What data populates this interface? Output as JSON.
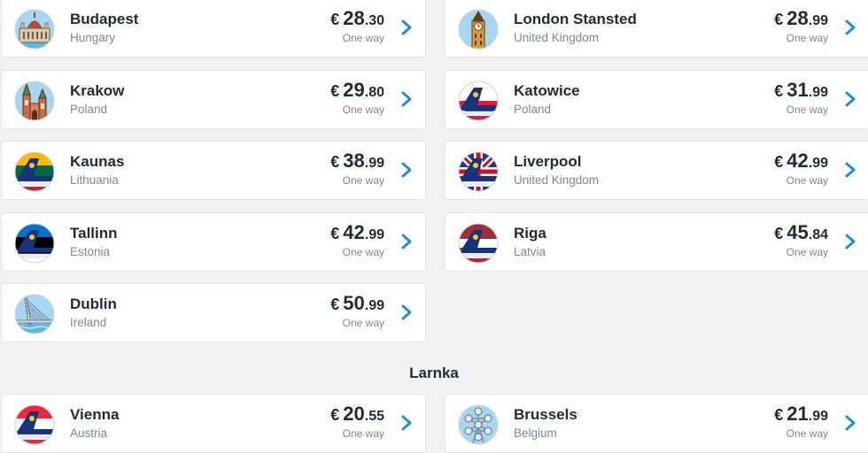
{
  "colors": {
    "accent": "#1e8fd6",
    "ryanair_blue": "#173479",
    "ryanair_yellow": "#f1c933"
  },
  "groups": [
    {
      "heading": "",
      "cards": [
        {
          "city": "Budapest",
          "country": "Hungary",
          "currency": "€",
          "price_int": "28",
          "price_dec": ".30",
          "note": "One way",
          "icon": "parliament-icon"
        },
        {
          "city": "London Stansted",
          "country": "United Kingdom",
          "currency": "€",
          "price_int": "28",
          "price_dec": ".99",
          "note": "One way",
          "icon": "big-ben-icon"
        },
        {
          "city": "Krakow",
          "country": "Poland",
          "currency": "€",
          "price_int": "29",
          "price_dec": ".80",
          "note": "One way",
          "icon": "church-icon"
        },
        {
          "city": "Katowice",
          "country": "Poland",
          "currency": "€",
          "price_int": "31",
          "price_dec": ".99",
          "note": "One way",
          "icon": "ryanair-tail-poland-icon"
        },
        {
          "city": "Kaunas",
          "country": "Lithuania",
          "currency": "€",
          "price_int": "38",
          "price_dec": ".99",
          "note": "One way",
          "icon": "ryanair-tail-lithuania-icon"
        },
        {
          "city": "Liverpool",
          "country": "United Kingdom",
          "currency": "€",
          "price_int": "42",
          "price_dec": ".99",
          "note": "One way",
          "icon": "ryanair-tail-uk-icon"
        },
        {
          "city": "Tallinn",
          "country": "Estonia",
          "currency": "€",
          "price_int": "42",
          "price_dec": ".99",
          "note": "One way",
          "icon": "ryanair-tail-estonia-icon"
        },
        {
          "city": "Riga",
          "country": "Latvia",
          "currency": "€",
          "price_int": "45",
          "price_dec": ".84",
          "note": "One way",
          "icon": "ryanair-tail-latvia-icon"
        },
        {
          "city": "Dublin",
          "country": "Ireland",
          "currency": "€",
          "price_int": "50",
          "price_dec": ".99",
          "note": "One way",
          "icon": "bridge-icon"
        }
      ]
    },
    {
      "heading": "Larnka",
      "cards": [
        {
          "city": "Vienna",
          "country": "Austria",
          "currency": "€",
          "price_int": "20",
          "price_dec": ".55",
          "note": "One way",
          "icon": "ryanair-tail-austria-icon"
        },
        {
          "city": "Brussels",
          "country": "Belgium",
          "currency": "€",
          "price_int": "21",
          "price_dec": ".99",
          "note": "One way",
          "icon": "atomium-icon"
        }
      ]
    }
  ]
}
